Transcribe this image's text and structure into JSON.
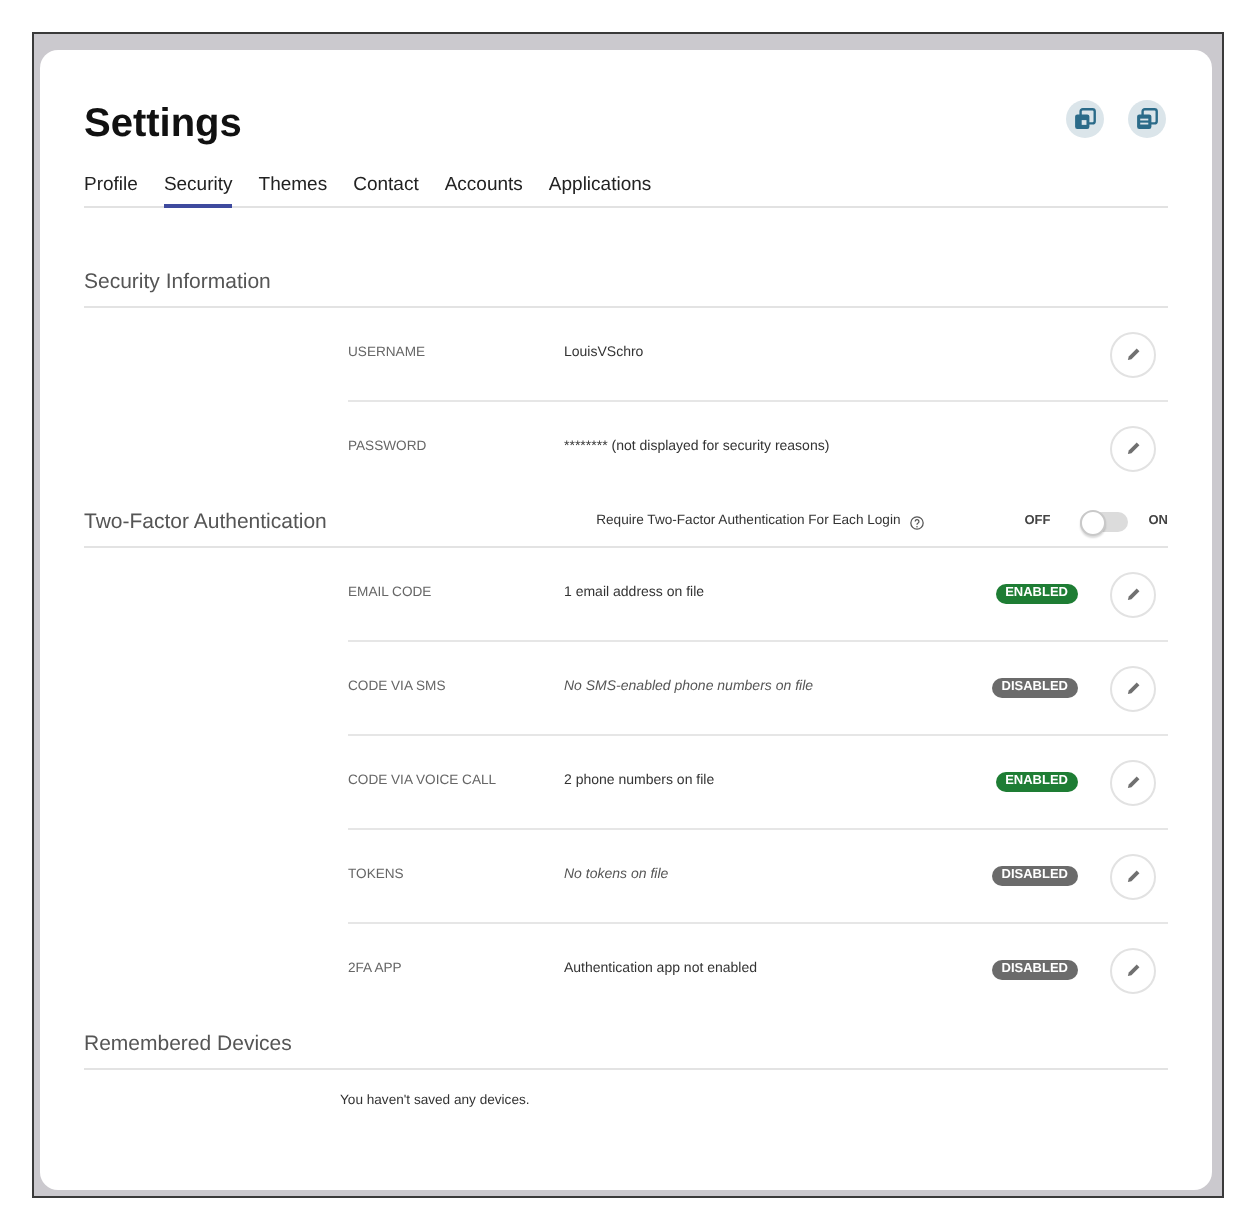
{
  "title": "Settings",
  "tabs": [
    {
      "label": "Profile",
      "selected": false
    },
    {
      "label": "Security",
      "selected": true
    },
    {
      "label": "Themes",
      "selected": false
    },
    {
      "label": "Contact",
      "selected": false
    },
    {
      "label": "Accounts",
      "selected": false
    },
    {
      "label": "Applications",
      "selected": false
    }
  ],
  "sections": [
    {
      "kind": "fields",
      "title": "Security Information",
      "rows": [
        {
          "label": "USERNAME",
          "value": "LouisVSchro",
          "empty": false
        },
        {
          "label": "PASSWORD",
          "value": "******** (not displayed for security reasons)",
          "empty": false
        }
      ]
    },
    {
      "kind": "methods",
      "title": "Two-Factor Authentication",
      "requirement": {
        "label": "Require Two-Factor Authentication For Each Login",
        "off_label": "OFF",
        "on_label": "ON",
        "on": false
      },
      "rows": [
        {
          "label": "EMAIL CODE",
          "value": "1 email address on file",
          "empty": false,
          "status": {
            "label": "ENABLED",
            "enabled": true
          }
        },
        {
          "label": "CODE VIA SMS",
          "value": "No SMS-enabled phone numbers on file",
          "empty": true,
          "status": {
            "label": "DISABLED",
            "enabled": false
          }
        },
        {
          "label": "CODE VIA VOICE CALL",
          "value": "2 phone numbers on file",
          "empty": false,
          "status": {
            "label": "ENABLED",
            "enabled": true
          }
        },
        {
          "label": "TOKENS",
          "value": "No tokens on file",
          "empty": true,
          "status": {
            "label": "DISABLED",
            "enabled": false
          }
        },
        {
          "label": "2FA APP",
          "value": "Authentication app not enabled",
          "empty": false,
          "status": {
            "label": "DISABLED",
            "enabled": false
          }
        }
      ]
    },
    {
      "kind": "devices",
      "title": "Remembered Devices",
      "message": "You haven't saved any devices."
    }
  ]
}
